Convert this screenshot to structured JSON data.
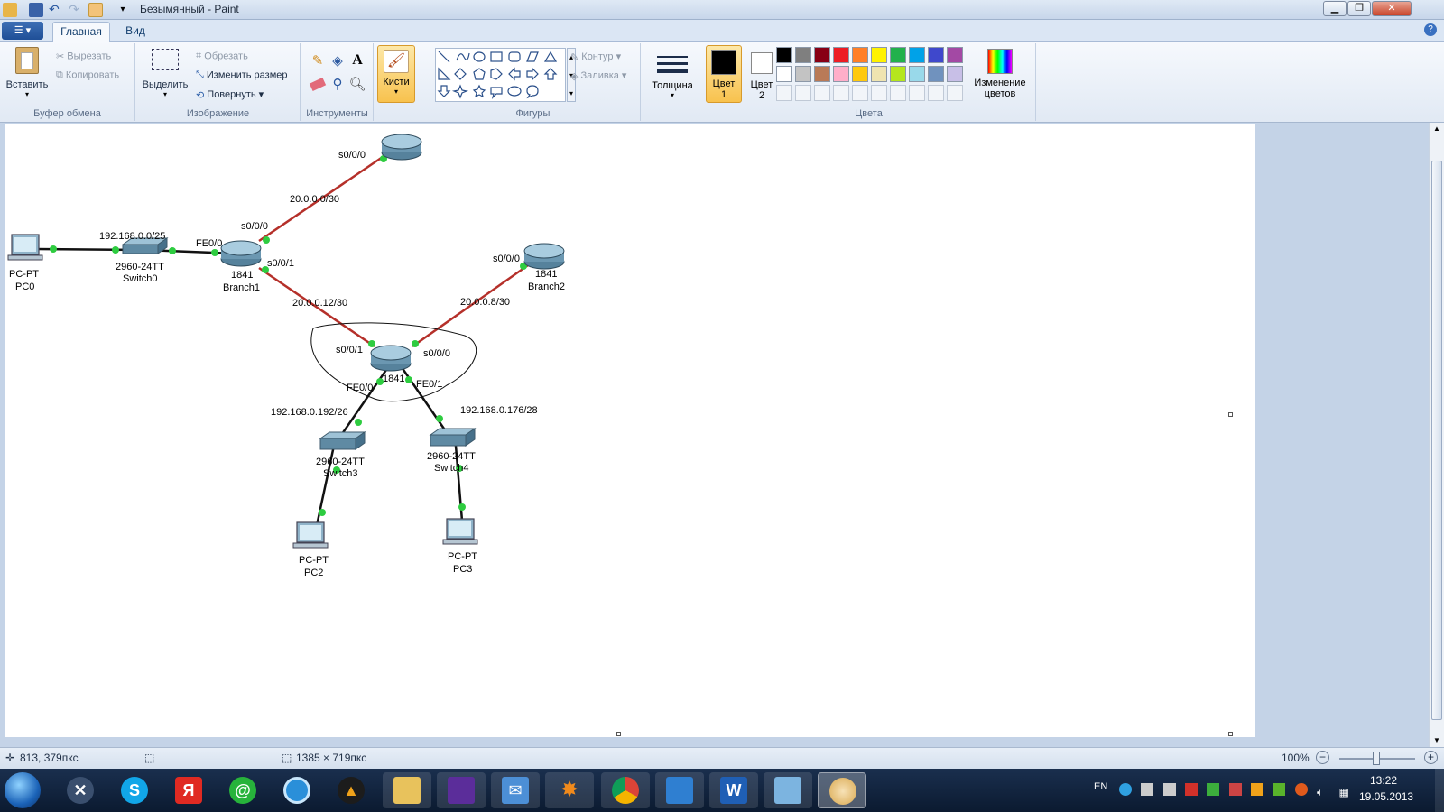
{
  "window": {
    "title": "Безымянный - Paint",
    "minimize": "▁",
    "maximize": "❐",
    "close": "✕"
  },
  "tabs": {
    "file": "☰ ▾",
    "home": "Главная",
    "view": "Вид",
    "help": "?"
  },
  "ribbon": {
    "clipboard": {
      "label": "Буфер обмена",
      "paste": "Вставить",
      "cut": "Вырезать",
      "copy": "Копировать"
    },
    "image": {
      "label": "Изображение",
      "select": "Выделить",
      "crop": "Обрезать",
      "resize": "Изменить размер",
      "rotate": "Повернуть"
    },
    "tools": {
      "label": "Инструменты"
    },
    "brushes": {
      "label": "Кисти"
    },
    "shapes": {
      "label": "Фигуры",
      "outline": "Контур",
      "fill": "Заливка"
    },
    "size": {
      "label": "Толщина"
    },
    "colors": {
      "label": "Цвета",
      "color1": "Цвет",
      "color1_num": "1",
      "color2": "Цвет",
      "color2_num": "2",
      "edit_colors": "Изменение",
      "edit_colors_2": "цветов",
      "palette_row1": [
        "#000000",
        "#7f7f7f",
        "#880015",
        "#ed1c24",
        "#ff7f27",
        "#fff200",
        "#22b14c",
        "#00a2e8",
        "#3f48cc",
        "#a349a4"
      ],
      "palette_row2": [
        "#ffffff",
        "#c3c3c3",
        "#b97a57",
        "#ffaec9",
        "#ffc90e",
        "#efe4b0",
        "#b5e61d",
        "#99d9ea",
        "#7092be",
        "#c8bfe7"
      ],
      "palette_row3_count": 10
    }
  },
  "diagram": {
    "devices": {
      "pc0": {
        "type": "PC-PT",
        "name": "PC0"
      },
      "switch0": {
        "model": "2960-24TT",
        "name": "Switch0"
      },
      "branch1": {
        "model": "1841",
        "name": "Branch1"
      },
      "top_router": {},
      "branch2": {
        "model": "1841",
        "name": "Branch2"
      },
      "center_router": {
        "model": "1841"
      },
      "switch3": {
        "model": "2960-24TT",
        "name": "Switch3"
      },
      "switch4": {
        "model": "2960-24TT",
        "name": "Switch4"
      },
      "pc2": {
        "type": "PC-PT",
        "name": "PC2"
      },
      "pc3": {
        "type": "PC-PT",
        "name": "PC3"
      }
    },
    "labels": {
      "net_pc0_sw0": "192.168.0.0/25",
      "b1_fe00": "FE0/0",
      "top_s000": "s0/0/0",
      "net_top": "20.0.0.0/30",
      "b1_s000": "s0/0/0",
      "b1_s001": "s0/0/1",
      "net_b1_center": "20.0.0.12/30",
      "b2_s000": "s0/0/0",
      "net_b2_center": "20.0.0.8/30",
      "c_s001": "s0/0/1",
      "c_s000": "s0/0/0",
      "c_fe00": "FE0/0",
      "c_fe01": "FE0/1",
      "net_sw3": "192.168.0.192/26",
      "net_sw4": "192.168.0.176/28"
    }
  },
  "status": {
    "cursor": "813, 379пкс",
    "size": "1385 × 719пкс",
    "zoom": "100%"
  },
  "taskbar": {
    "lang": "EN",
    "time": "13:22",
    "date": "19.05.2013"
  }
}
